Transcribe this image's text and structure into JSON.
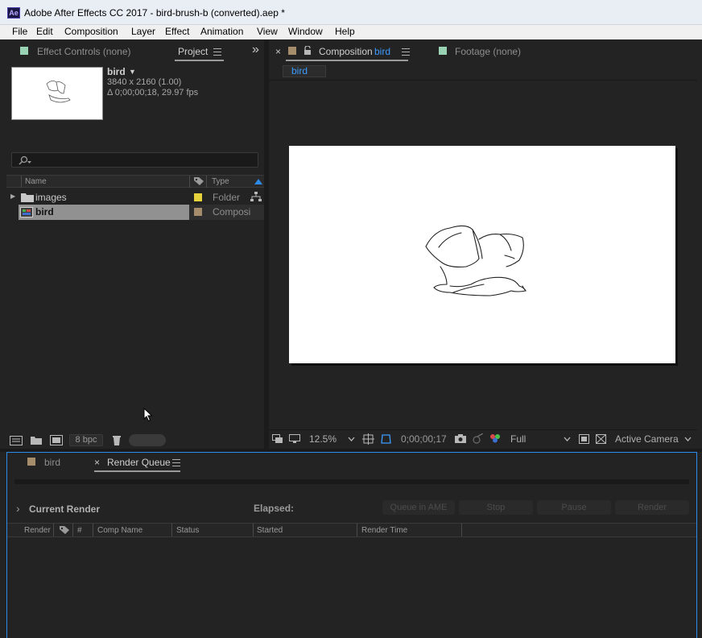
{
  "window": {
    "app_icon": "Ae",
    "title": "Adobe After Effects CC 2017 - bird-brush-b (converted).aep *"
  },
  "menu": [
    "File",
    "Edit",
    "Composition",
    "Layer",
    "Effect",
    "Animation",
    "View",
    "Window",
    "Help"
  ],
  "left_panel": {
    "tab_effect_controls": "Effect Controls (none)",
    "tab_project": "Project",
    "more_glyph": "»",
    "preview": {
      "name": "bird",
      "dropdown_glyph": "▼",
      "resolution": "3840 x 2160 (1.00)",
      "duration": "Δ 0;00;00;18, 29.97 fps"
    },
    "search_placeholder": "",
    "columns": {
      "name": "Name",
      "type": "Type"
    },
    "items": [
      {
        "name": "images",
        "type": "Folder",
        "label_color": "#e6d23a",
        "expand_glyph": "▶"
      },
      {
        "name": "bird",
        "type": "Composi",
        "label_color": "#a58c6b",
        "selected": true
      }
    ],
    "footer": {
      "bpc": "8 bpc"
    }
  },
  "viewer": {
    "close_glyph": "×",
    "tab_composition_prefix": "Composition",
    "tab_composition_name": "bird",
    "tab_footage": "Footage (none)",
    "breadcrumb": "bird",
    "zoom": "12.5%",
    "timecode": "0;00;00;17",
    "resolution": "Full",
    "camera": "Active Camera"
  },
  "bottom": {
    "tab_bird": "bird",
    "tab_render_queue": "Render Queue",
    "close_glyph": "×",
    "current_render": "Current Render",
    "expand_glyph": "›",
    "elapsed_label": "Elapsed:",
    "buttons": {
      "queue_ame": "Queue in AME",
      "stop": "Stop",
      "pause": "Pause",
      "render": "Render"
    },
    "columns": [
      "Render",
      "#",
      "Comp Name",
      "Status",
      "Started",
      "Render Time"
    ]
  },
  "colors": {
    "accent_blue": "#2d8ceb",
    "panel_bg": "#232323",
    "comp_label": "#a58c6b",
    "footage_label": "#9ad3b4",
    "folder_label": "#e6d23a"
  }
}
